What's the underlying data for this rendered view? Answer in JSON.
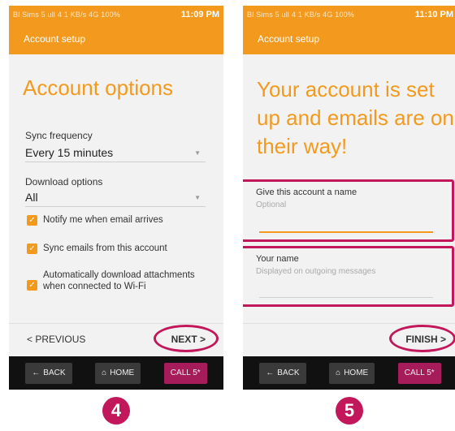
{
  "screen1": {
    "status": {
      "left": "Bl Sims  5 ull  4 1 KB/s  4G  100%",
      "time": "11:09 PM"
    },
    "appbar_title": "Account setup",
    "title": "Account options",
    "sync": {
      "label": "Sync frequency",
      "value": "Every 15 minutes"
    },
    "download": {
      "label": "Download options",
      "value": "All"
    },
    "checkboxes": [
      {
        "label": "Notify me when email arrives",
        "checked": true
      },
      {
        "label": "Sync emails from this account",
        "checked": true
      },
      {
        "label": "Automatically download attachments when connected to Wi-Fi",
        "checked": true
      }
    ],
    "prev_label": "< PREVIOUS",
    "next_label": "NEXT >",
    "sys": {
      "back": "BACK",
      "home": "HOME",
      "call": "CALL 5*"
    },
    "step": "4"
  },
  "screen2": {
    "status": {
      "left": "Bl Sims  5 ull  4 1 KB/s  4G  100%",
      "time": "11:10 PM"
    },
    "appbar_title": "Account setup",
    "title": "Your account is set up and emails are on their way!",
    "account_name": {
      "label": "Give this account a name",
      "hint": "Optional"
    },
    "your_name": {
      "label": "Your name",
      "hint": "Displayed on outgoing messages"
    },
    "finish_label": "FINISH >",
    "sys": {
      "back": "BACK",
      "home": "HOME",
      "call": "CALL 5*"
    },
    "step": "5"
  },
  "colors": {
    "accent": "#f39a1e",
    "highlight": "#c2185b",
    "sysbar": "#111111"
  }
}
